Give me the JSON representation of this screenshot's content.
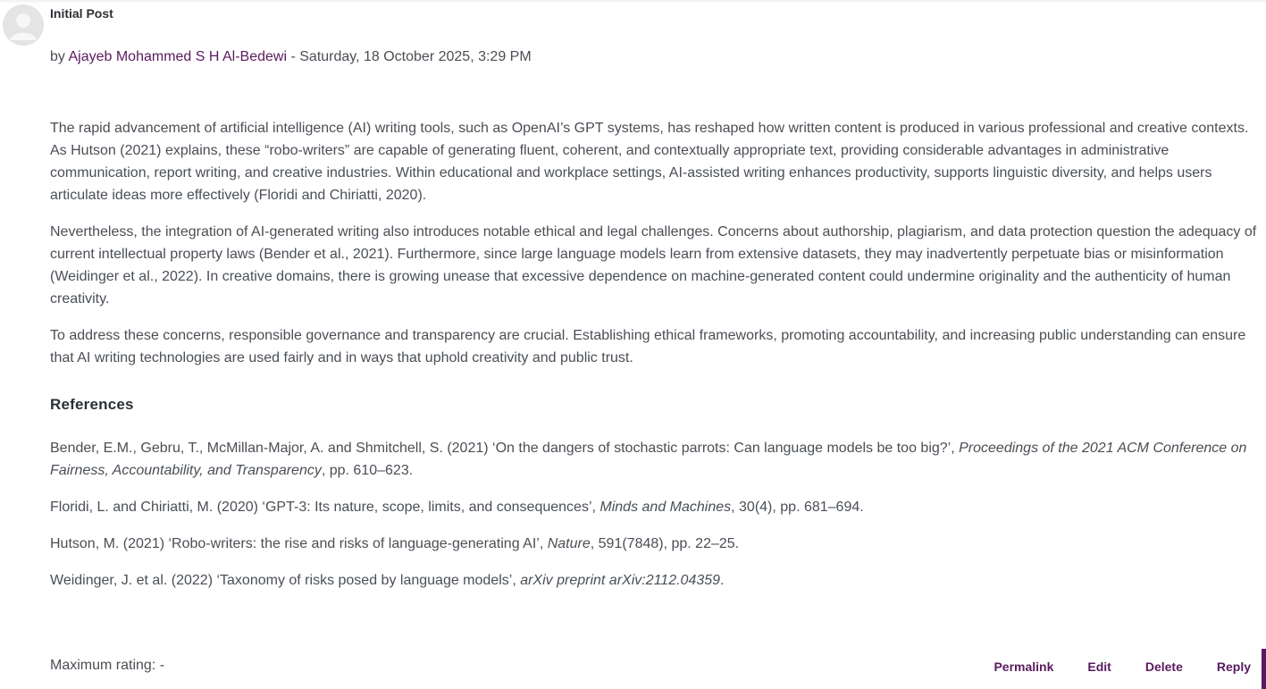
{
  "post": {
    "subject": "Initial Post",
    "by_prefix": "by ",
    "author": "Ajayeb Mohammed S H Al-Bedewi",
    "date_sep": " - ",
    "date": "Saturday, 18 October 2025, 3:29 PM"
  },
  "content": {
    "paragraphs": [
      "The rapid advancement of artificial intelligence (AI) writing tools, such as OpenAI’s GPT systems, has reshaped how written content is produced in various professional and creative contexts. As Hutson (2021) explains, these “robo-writers” are capable of generating fluent, coherent, and contextually appropriate text, providing considerable advantages in administrative communication, report writing, and creative industries. Within educational and workplace settings, AI-assisted writing enhances productivity, supports linguistic diversity, and helps users articulate ideas more effectively (Floridi and Chiriatti, 2020).",
      "Nevertheless, the integration of AI-generated writing also introduces notable ethical and legal challenges. Concerns about authorship, plagiarism, and data protection question the adequacy of current intellectual property laws (Bender et al., 2021). Furthermore, since large language models learn from extensive datasets, they may inadvertently perpetuate bias or misinformation (Weidinger et al., 2022). In creative domains, there is growing unease that excessive dependence on machine-generated content could undermine originality and the authenticity of human creativity.",
      "To address these concerns, responsible governance and transparency are crucial. Establishing ethical frameworks, promoting accountability, and increasing public understanding can ensure that AI writing technologies are used fairly and in ways that uphold creativity and public trust."
    ],
    "references_heading": "References",
    "references": [
      {
        "pre": "Bender, E.M., Gebru, T., McMillan-Major, A. and Shmitchell, S. (2021) ‘On the dangers of stochastic parrots: Can language models be too big?’, ",
        "italic": "Proceedings of the 2021 ACM Conference on Fairness, Accountability, and Transparency",
        "post": ", pp. 610–623."
      },
      {
        "pre": "Floridi, L. and Chiriatti, M. (2020) ‘GPT-3: Its nature, scope, limits, and consequences’, ",
        "italic": "Minds and Machines",
        "post": ", 30(4), pp. 681–694."
      },
      {
        "pre": "Hutson, M. (2021) ‘Robo-writers: the rise and risks of language-generating AI’, ",
        "italic": "Nature",
        "post": ", 591(7848), pp. 22–25."
      },
      {
        "pre": "Weidinger, J. et al. (2022) ‘Taxonomy of risks posed by language models’, ",
        "italic": "arXiv preprint arXiv:2112.04359",
        "post": "."
      }
    ]
  },
  "footer": {
    "rating": "Maximum rating: -",
    "permalink": "Permalink",
    "edit": "Edit",
    "delete": "Delete",
    "reply": "Reply"
  },
  "colors": {
    "link": "#5a1b5e",
    "text": "#4a4f55"
  },
  "icons": {
    "avatar": "default-user-avatar-icon"
  }
}
